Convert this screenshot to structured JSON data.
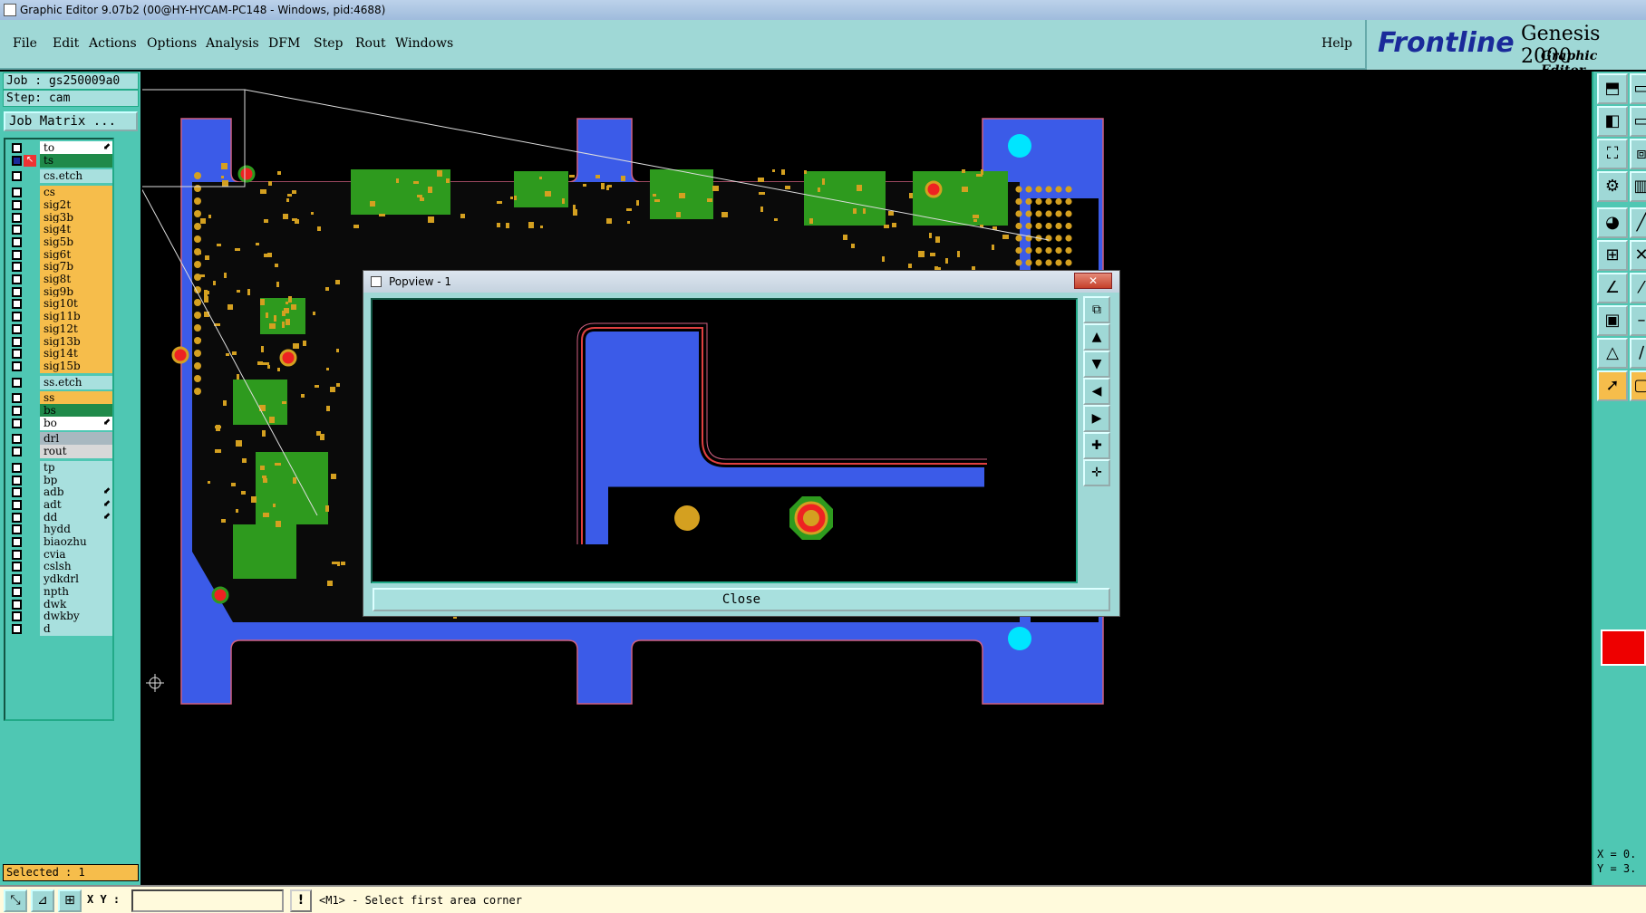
{
  "window": {
    "title": "Graphic Editor 9.07b2 (00@HY-HYCAM-PC148 - Windows, pid:4688)"
  },
  "menu": {
    "items": [
      "File",
      "Edit",
      "Actions",
      "Options",
      "Analysis",
      "DFM",
      "Step",
      "Rout",
      "Windows"
    ],
    "help": "Help"
  },
  "brand": {
    "logo": "Frontline",
    "product": "Genesis 2000",
    "subtitle": "Graphic Editor"
  },
  "job": {
    "job_line": "Job : gs250009a0",
    "step_line": "Step: cam",
    "matrix_button": "Job Matrix ..."
  },
  "layers": [
    {
      "name": "to",
      "color": "#ffffff",
      "mark": "arrow"
    },
    {
      "name": "ts",
      "color": "#1f8a4a",
      "mark": "",
      "icon": "cursor"
    },
    {
      "name": "cs.etch",
      "color": "#a8e0de",
      "mark": ""
    },
    {
      "name": "cs",
      "color": "#f6bd4b",
      "mark": ""
    },
    {
      "name": "sig2t",
      "color": "#f6bd4b",
      "mark": ""
    },
    {
      "name": "sig3b",
      "color": "#f6bd4b",
      "mark": ""
    },
    {
      "name": "sig4t",
      "color": "#f6bd4b",
      "mark": ""
    },
    {
      "name": "sig5b",
      "color": "#f6bd4b",
      "mark": ""
    },
    {
      "name": "sig6t",
      "color": "#f6bd4b",
      "mark": ""
    },
    {
      "name": "sig7b",
      "color": "#f6bd4b",
      "mark": ""
    },
    {
      "name": "sig8t",
      "color": "#f6bd4b",
      "mark": ""
    },
    {
      "name": "sig9b",
      "color": "#f6bd4b",
      "mark": ""
    },
    {
      "name": "sig10t",
      "color": "#f6bd4b",
      "mark": ""
    },
    {
      "name": "sig11b",
      "color": "#f6bd4b",
      "mark": ""
    },
    {
      "name": "sig12t",
      "color": "#f6bd4b",
      "mark": ""
    },
    {
      "name": "sig13b",
      "color": "#f6bd4b",
      "mark": ""
    },
    {
      "name": "sig14t",
      "color": "#f6bd4b",
      "mark": ""
    },
    {
      "name": "sig15b",
      "color": "#f6bd4b",
      "mark": ""
    },
    {
      "name": "ss.etch",
      "color": "#a8e0de",
      "mark": ""
    },
    {
      "name": "ss",
      "color": "#f6bd4b",
      "mark": ""
    },
    {
      "name": "bs",
      "color": "#1f8a4a",
      "mark": ""
    },
    {
      "name": "bo",
      "color": "#ffffff",
      "mark": "arrow"
    },
    {
      "name": "drl",
      "color": "#a8b8c0",
      "mark": ""
    },
    {
      "name": "rout",
      "color": "#d8d8d8",
      "mark": ""
    },
    {
      "name": "tp",
      "color": "#a8e0de",
      "mark": ""
    },
    {
      "name": "bp",
      "color": "#a8e0de",
      "mark": ""
    },
    {
      "name": "adb",
      "color": "#a8e0de",
      "mark": "arrow"
    },
    {
      "name": "adt",
      "color": "#a8e0de",
      "mark": "arrow"
    },
    {
      "name": "dd",
      "color": "#a8e0de",
      "mark": "arrow"
    },
    {
      "name": "hydd",
      "color": "#a8e0de",
      "mark": ""
    },
    {
      "name": "biaozhu",
      "color": "#a8e0de",
      "mark": ""
    },
    {
      "name": "cvia",
      "color": "#a8e0de",
      "mark": ""
    },
    {
      "name": "cslsh",
      "color": "#a8e0de",
      "mark": ""
    },
    {
      "name": "ydkdrl",
      "color": "#a8e0de",
      "mark": ""
    },
    {
      "name": "npth",
      "color": "#a8e0de",
      "mark": ""
    },
    {
      "name": "dwk",
      "color": "#a8e0de",
      "mark": ""
    },
    {
      "name": "dwkby",
      "color": "#a8e0de",
      "mark": ""
    },
    {
      "name": "d",
      "color": "#a8e0de",
      "mark": ""
    }
  ],
  "selected": "Selected : 1",
  "popview": {
    "title": "Popview - 1",
    "close_label": "Close",
    "close_x": "✕"
  },
  "status": {
    "xy_label": "X Y :",
    "xy_value": "",
    "excl": "!",
    "message": "<M1> - Select first area corner"
  },
  "coords": {
    "x": "X = 0.",
    "y": "Y = 3."
  },
  "colors": {
    "board_blue": "#3b5be8",
    "copper": "#d4a020",
    "mask_green": "#2e9a1e",
    "cyan_hole": "#00e5ff"
  }
}
